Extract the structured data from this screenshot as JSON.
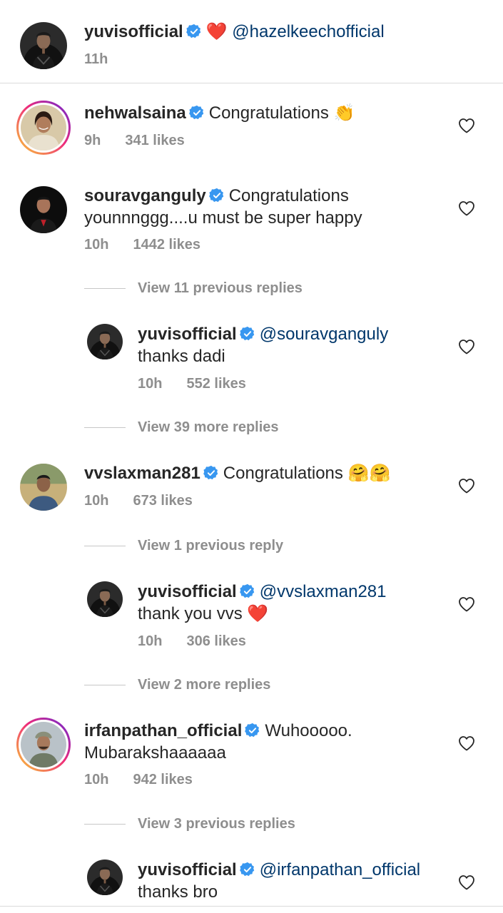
{
  "caption": {
    "username": "yuvisofficial",
    "emoji": "❤️",
    "mention": "@hazelkeechofficial",
    "time": "11h"
  },
  "comments": [
    {
      "username": "nehwalsaina",
      "text": "Congratulations",
      "emoji": "👏",
      "time": "9h",
      "likes": "341 likes"
    },
    {
      "username": "souravganguly",
      "text_line1": "Congratulations",
      "text_line2": "younnnggg....u must be super happy",
      "time": "10h",
      "likes": "1442 likes",
      "view_previous": "View 11 previous replies",
      "reply": {
        "username": "yuvisofficial",
        "mention": "@souravganguly",
        "text": "thanks dadi",
        "time": "10h",
        "likes": "552 likes"
      },
      "view_more": "View 39 more replies"
    },
    {
      "username": "vvslaxman281",
      "text": "Congratulations",
      "emoji": "🤗🤗",
      "time": "10h",
      "likes": "673 likes",
      "view_previous": "View 1 previous reply",
      "reply": {
        "username": "yuvisofficial",
        "mention": "@vvslaxman281",
        "text": "thank you vvs",
        "emoji": "❤️",
        "time": "10h",
        "likes": "306 likes"
      },
      "view_more": "View 2 more replies"
    },
    {
      "username": "irfanpathan_official",
      "text_line1": "Wuhooooo.",
      "text_line2": "Mubarakshaaaaaa",
      "time": "10h",
      "likes": "942 likes",
      "view_previous": "View 3 previous replies",
      "reply": {
        "username": "yuvisofficial",
        "mention": "@irfanpathan_official",
        "text": "thanks bro"
      }
    }
  ],
  "icons": {
    "verified": "verified-badge-icon",
    "like": "heart-outline-icon"
  },
  "colors": {
    "verified": "#3897f0",
    "mention": "#00376b",
    "meta": "#8e8e8e",
    "text": "#262626"
  }
}
